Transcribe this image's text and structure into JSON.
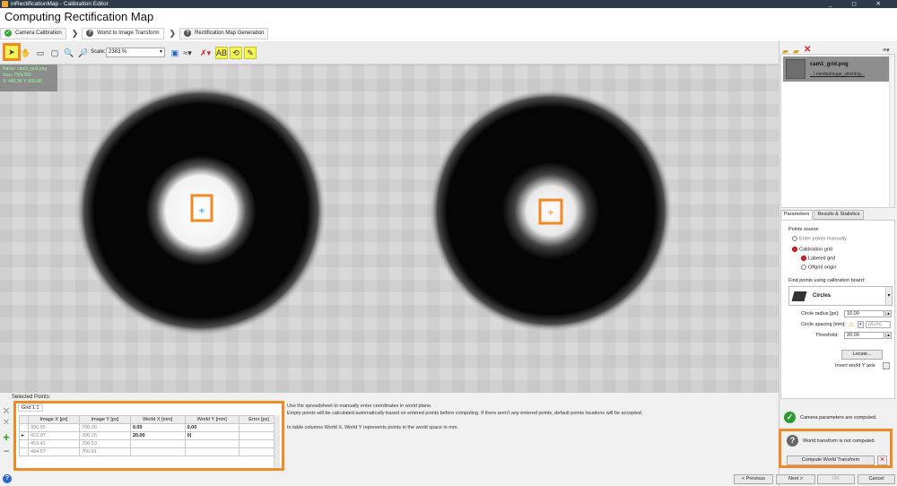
{
  "window": {
    "title": "inRectificationMap - Calibration Editor",
    "controls": "_ ◻ ✕"
  },
  "page": {
    "title": "Computing Rectification Map"
  },
  "steps": [
    {
      "label": "Camera Calibration",
      "icon": "check-icon",
      "color": "#3aa63a"
    },
    {
      "label": "World to Image Transform",
      "icon": "question-icon",
      "color": "#555555"
    },
    {
      "label": "Rectification Map Generation",
      "icon": "question-icon",
      "color": "#555555"
    }
  ],
  "toolbar": {
    "scale_label": "Scale:",
    "scale_value": "2383 %"
  },
  "image_info": {
    "line1": "Name: cam1_grid.png",
    "line2": "Size: 750x780",
    "line3": "X: 449.36 Y: 609.86"
  },
  "files": {
    "name": "cam1_grid.png",
    "path": "...\\ media\\image_stitching..."
  },
  "right_tabs": [
    "Parameters",
    "Results & Statistics"
  ],
  "params": {
    "points_source_label": "Points source:",
    "opt_manual": "Enter points manually",
    "opt_grid": "Calibration grid",
    "opt_labeled": "Labeled grid",
    "opt_offgrid": "Offgrid origin",
    "find_label": "Find points using calibration board:",
    "board": "Circles",
    "radius_label": "Circle radius [px]:",
    "radius_value": "10.00",
    "spacing_label": "Circle spacing [mm]:",
    "spacing_value": "(Auto)",
    "threshold_label": "Threshold:",
    "threshold_value": "20.00",
    "locate_button": "Locate...",
    "invert_label": "Invert world Y axis"
  },
  "status": {
    "camera": "Camera parameters are computed.",
    "world": "World transform is not computed.",
    "compute_button": "Compute World Transform"
  },
  "nav": {
    "previous": "< Previous",
    "next": "Next >",
    "ok": "OK",
    "cancel": "Cancel"
  },
  "selected": {
    "label": "Selected Points:",
    "grid_tab": "Grid 1.1",
    "columns": [
      "Image X [px]",
      "Image Y [px]",
      "World X [mm]",
      "World Y [mm]",
      "Error [px]"
    ],
    "rows": [
      [
        "390.65",
        "700.06",
        "0.00",
        "0.00",
        ""
      ],
      [
        "422.07",
        "700.25",
        "20.00",
        "0|",
        ""
      ],
      [
        "453.41",
        "700.53",
        "",
        "",
        ""
      ],
      [
        "484.57",
        "700.81",
        "",
        "",
        ""
      ]
    ]
  },
  "help": {
    "line1": "Use the spreadsheet to manually enter coordinates in world plane.",
    "line2": "Empty points will be calculated automatically based on entered points before computing. If there aren't any entered points, default points locations will be accepted.",
    "line3": "In table columns World X, World Y represents points in the world space in mm."
  },
  "colors": {
    "highlight": "#f08a24",
    "marker_blue": "#1e90ff",
    "marker_orange": "#f08a24"
  }
}
